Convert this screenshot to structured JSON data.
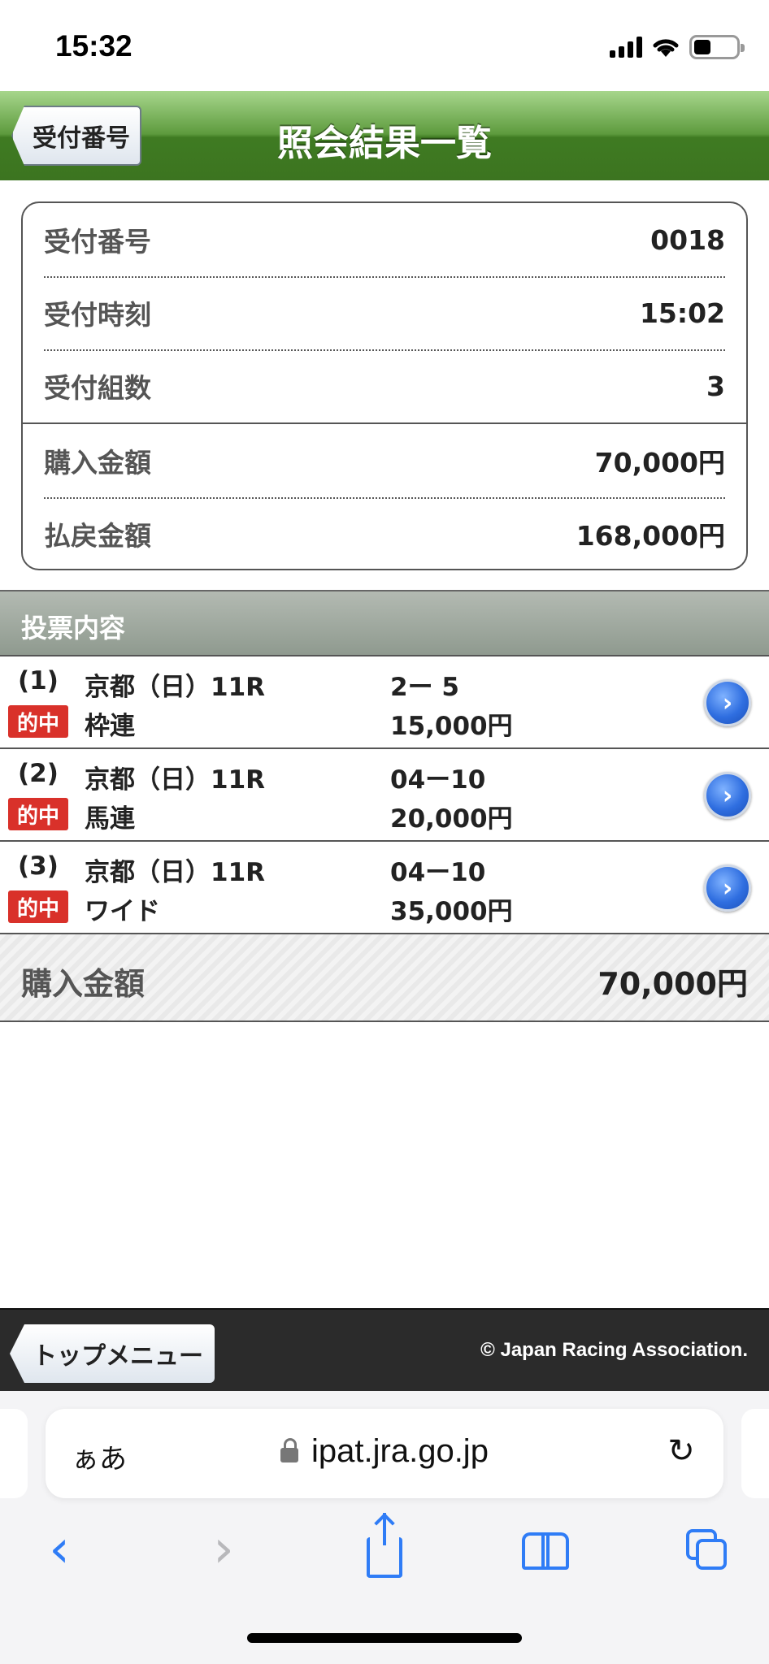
{
  "status_bar": {
    "time": "15:32"
  },
  "header": {
    "back_label": "受付番号",
    "title": "照会結果一覧"
  },
  "summary": {
    "rows": [
      {
        "label": "受付番号",
        "value": "0018"
      },
      {
        "label": "受付時刻",
        "value": "15:02"
      },
      {
        "label": "受付組数",
        "value": "3"
      },
      {
        "label": "購入金額",
        "value": "70,000円"
      },
      {
        "label": "払戻金額",
        "value": "168,000円"
      }
    ]
  },
  "section": {
    "title": "投票内容"
  },
  "bets": [
    {
      "index": "(1)",
      "race": "京都（日）11R",
      "combo": "2ー 5",
      "badge": "的中",
      "type": "枠連",
      "amount": "15,000円"
    },
    {
      "index": "(2)",
      "race": "京都（日）11R",
      "combo": "04ー10",
      "badge": "的中",
      "type": "馬連",
      "amount": "20,000円"
    },
    {
      "index": "(3)",
      "race": "京都（日）11R",
      "combo": "04ー10",
      "badge": "的中",
      "type": "ワイド",
      "amount": "35,000円"
    }
  ],
  "total": {
    "label": "購入金額",
    "value": "70,000円"
  },
  "footer": {
    "top_menu_label": "トップメニュー",
    "copyright": "© Japan Racing Association."
  },
  "browser": {
    "text_size_label": "ぁあ",
    "url": "ipat.jra.go.jp"
  },
  "colors": {
    "header_green": "#4a8a2c",
    "hit_red": "#d9312a",
    "link_blue": "#2f7cf6"
  }
}
